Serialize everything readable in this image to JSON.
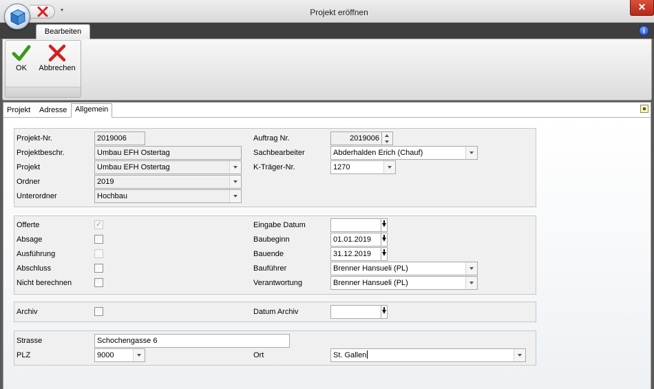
{
  "window": {
    "title": "Projekt eröffnen",
    "close_label": "✕"
  },
  "ribbon": {
    "tab_label": "Bearbeiten",
    "ok_label": "OK",
    "cancel_label": "Abbrechen",
    "help_label": "i"
  },
  "tabs": [
    {
      "label": "Projekt"
    },
    {
      "label": "Adresse"
    },
    {
      "label": "Allgemein",
      "active": true
    }
  ],
  "general": {
    "projekt_nr": {
      "label": "Projekt-Nr.",
      "value": "2019006"
    },
    "projektbeschr": {
      "label": "Projektbeschr.",
      "value": "Umbau EFH Ostertag"
    },
    "projekt": {
      "label": "Projekt",
      "value": "Umbau EFH Ostertag"
    },
    "ordner": {
      "label": "Ordner",
      "value": "2019"
    },
    "unterordner": {
      "label": "Unterordner",
      "value": "Hochbau"
    },
    "auftrag_nr": {
      "label": "Auftrag Nr.",
      "value": "2019006"
    },
    "sachbearbeiter": {
      "label": "Sachbearbeiter",
      "value": "Abderhalden Erich (Chauf)"
    },
    "k_traeger_nr": {
      "label": "K-Träger-Nr.",
      "value": "1270"
    }
  },
  "status": {
    "offerte": {
      "label": "Offerte",
      "checked": true,
      "disabled": true
    },
    "absage": {
      "label": "Absage",
      "checked": false
    },
    "ausfuehrung": {
      "label": "Ausführung",
      "checked": false,
      "disabled": true
    },
    "abschluss": {
      "label": "Abschluss",
      "checked": false
    },
    "nicht_berechnen": {
      "label": "Nicht berechnen",
      "checked": false
    },
    "eingabe_datum": {
      "label": "Eingabe Datum",
      "value": ""
    },
    "baubeginn": {
      "label": "Baubeginn",
      "value": "01.01.2019"
    },
    "bauende": {
      "label": "Bauende",
      "value": "31.12.2019"
    },
    "baufuehrer": {
      "label": "Bauführer",
      "value": "Brenner Hansueli (PL)"
    },
    "verantwortung": {
      "label": "Verantwortung",
      "value": "Brenner Hansueli (PL)"
    }
  },
  "archive": {
    "archiv": {
      "label": "Archiv",
      "checked": false
    },
    "datum_archiv": {
      "label": "Datum Archiv",
      "value": ""
    }
  },
  "address": {
    "strasse": {
      "label": "Strasse",
      "value": "Schochengasse 6"
    },
    "plz": {
      "label": "PLZ",
      "value": "9000"
    },
    "ort": {
      "label": "Ort",
      "value": "St. Gallen"
    }
  },
  "colors": {
    "accent_blue": "#1b3fd0",
    "close_red": "#c13a27",
    "ok_green": "#3a9a1a",
    "cancel_red": "#d42020"
  }
}
